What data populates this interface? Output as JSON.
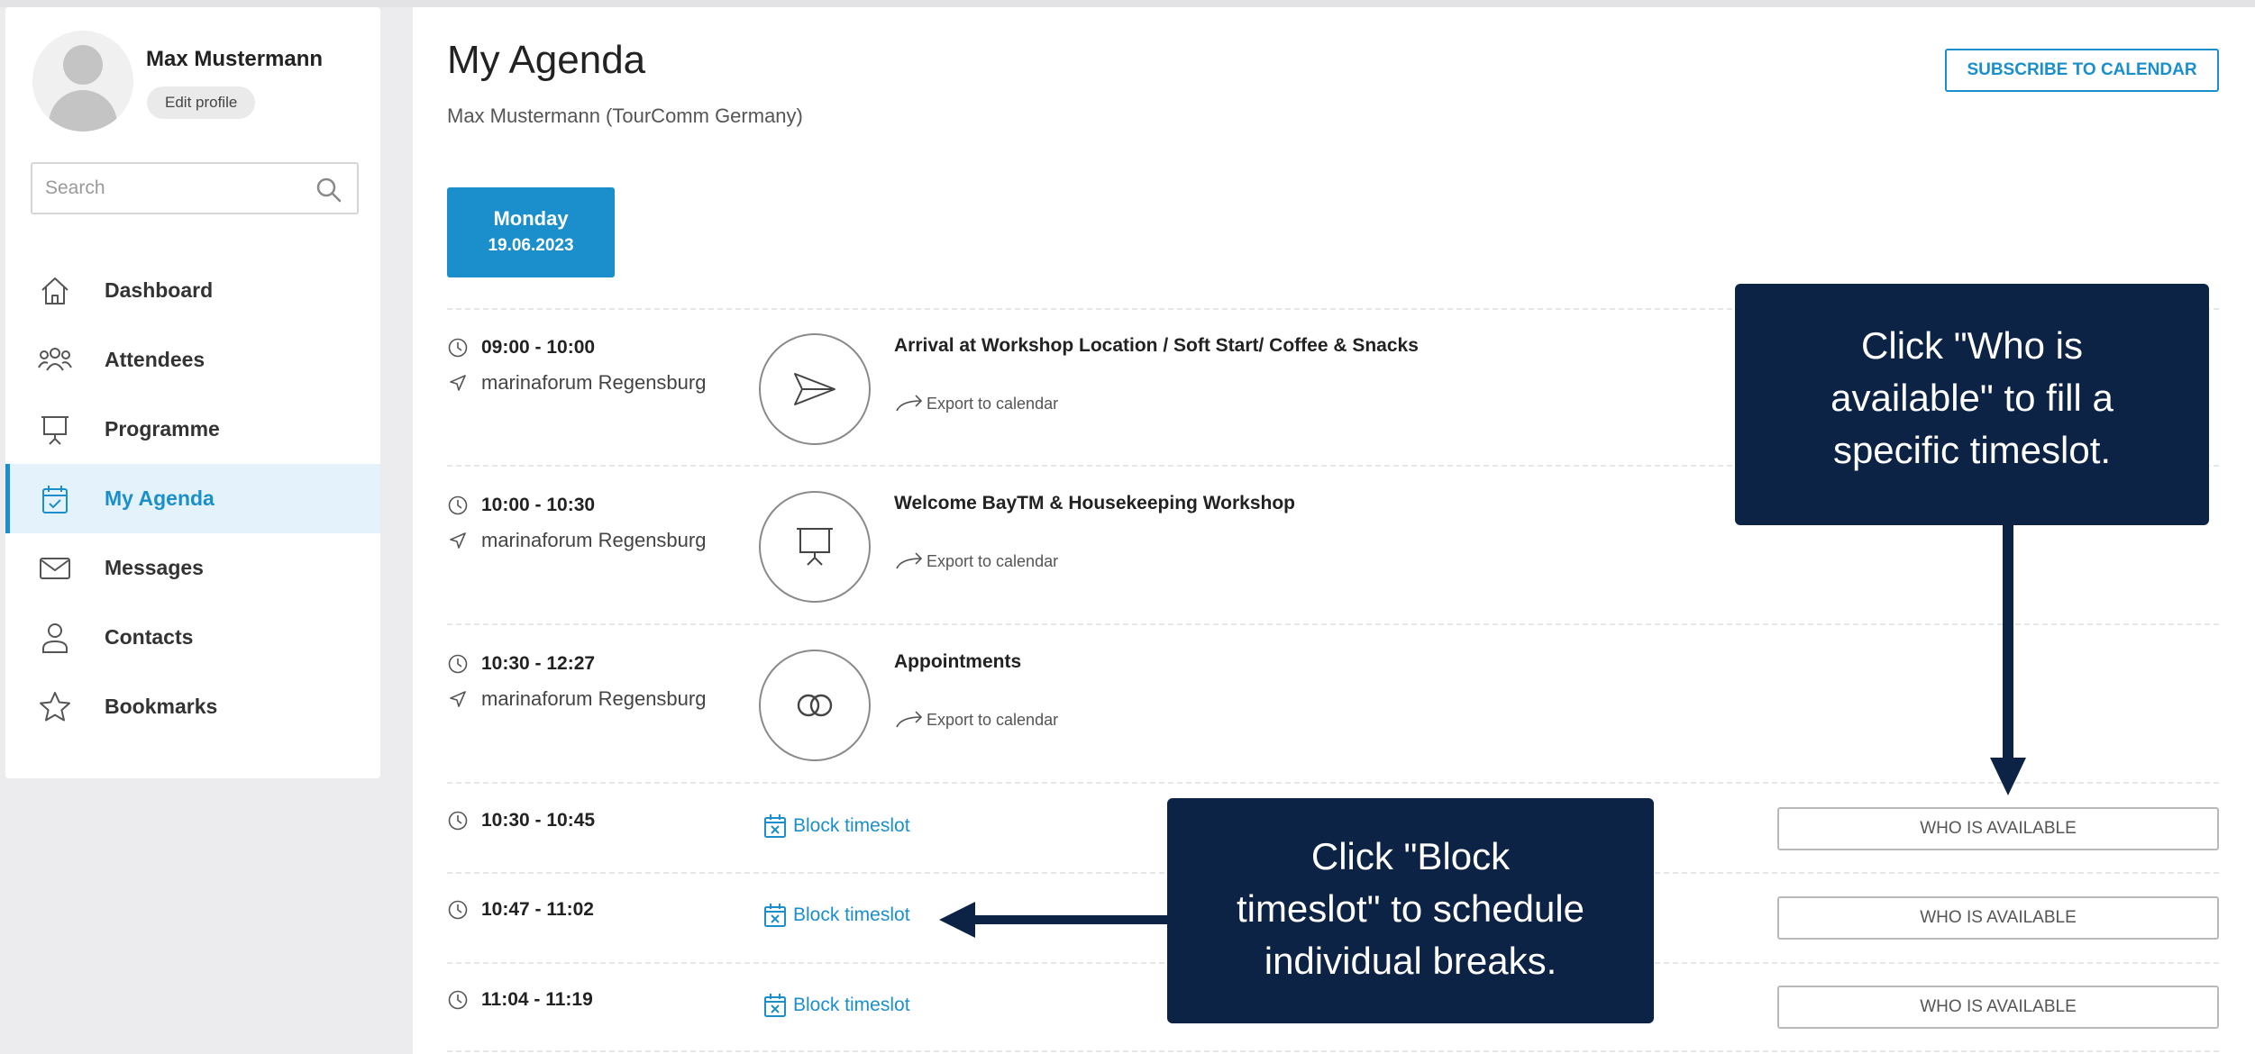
{
  "sidebar": {
    "user_name": "Max Mustermann",
    "edit_profile_label": "Edit profile",
    "search_placeholder": "Search",
    "nav": [
      {
        "label": "Dashboard",
        "icon": "home-icon",
        "active": false
      },
      {
        "label": "Attendees",
        "icon": "people-icon",
        "active": false
      },
      {
        "label": "Programme",
        "icon": "presentation-icon",
        "active": false
      },
      {
        "label": "My Agenda",
        "icon": "calendar-check-icon",
        "active": true
      },
      {
        "label": "Messages",
        "icon": "envelope-icon",
        "active": false
      },
      {
        "label": "Contacts",
        "icon": "person-icon",
        "active": false
      },
      {
        "label": "Bookmarks",
        "icon": "star-icon",
        "active": false
      }
    ]
  },
  "header": {
    "title": "My Agenda",
    "subtitle": "Max Mustermann (TourComm Germany)",
    "subscribe_label": "SUBSCRIBE TO CALENDAR"
  },
  "day_tab": {
    "day": "Monday",
    "date": "19.06.2023"
  },
  "events": [
    {
      "time": "09:00 - 10:00",
      "location": "marinaforum Regensburg",
      "title": "Arrival at Workshop Location / Soft Start/ Coffee & Snacks",
      "export_label": "Export to calendar",
      "icon": "paper-plane-icon"
    },
    {
      "time": "10:00 - 10:30",
      "location": "marinaforum Regensburg",
      "title": "Welcome BayTM & Housekeeping Workshop",
      "export_label": "Export to calendar",
      "icon": "presentation-icon"
    },
    {
      "time": "10:30 - 12:27",
      "location": "marinaforum Regensburg",
      "title": "Appointments",
      "export_label": "Export to calendar",
      "icon": "interlocking-rings-icon"
    }
  ],
  "slots": [
    {
      "time": "10:30 - 10:45",
      "block_label": "Block timeslot",
      "who_label": "WHO IS AVAILABLE"
    },
    {
      "time": "10:47 - 11:02",
      "block_label": "Block timeslot",
      "who_label": "WHO IS AVAILABLE"
    },
    {
      "time": "11:04 - 11:19",
      "block_label": "Block timeslot",
      "who_label": "WHO IS AVAILABLE"
    }
  ],
  "callouts": {
    "who_is_available": [
      "Click \"Who is",
      "available\" to fill a",
      "specific timeslot."
    ],
    "block_timeslot": [
      "Click \"Block",
      "timeslot\" to schedule",
      "individual breaks."
    ]
  },
  "colors": {
    "accent": "#1b8fcc",
    "callout_bg": "#0d2346",
    "active_nav_bg": "#e4f3fb"
  }
}
